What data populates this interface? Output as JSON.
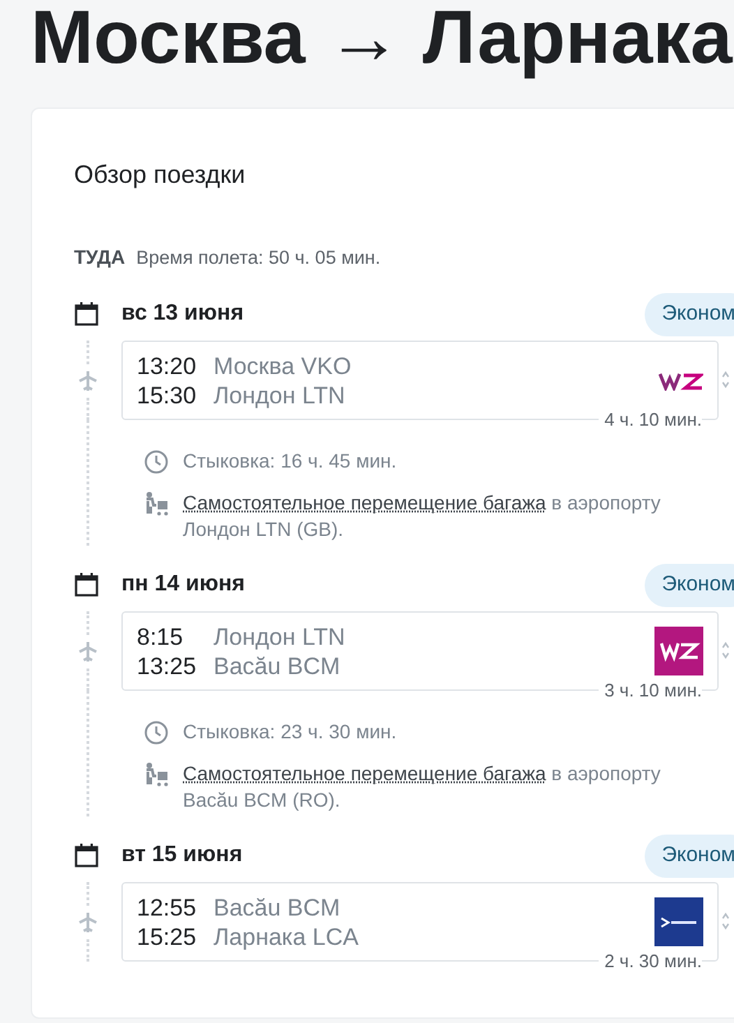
{
  "title": "Москва → Ларнака",
  "overview": {
    "heading": "Обзор поездки",
    "direction": "ТУДА",
    "flight_time": "Время полета: 50 ч. 05 мин."
  },
  "legs": [
    {
      "date": "вс 13 июня",
      "cabin": "Эконом",
      "departure": {
        "time": "13:20",
        "place": "Москва VKO"
      },
      "arrival": {
        "time": "15:30",
        "place": "Лондон LTN"
      },
      "duration": "4 ч. 10 мин.",
      "logo": {
        "kind": "wizz_plain"
      },
      "layover": {
        "connection": "Стыковка: 16 ч. 45 мин.",
        "baggage_link": "Самостоятельное перемещение багажа",
        "baggage_rest": "в аэропорту Лондон LTN (GB)."
      }
    },
    {
      "date": "пн 14 июня",
      "cabin": "Эконом",
      "departure": {
        "time": "8:15",
        "place": "Лондон LTN"
      },
      "arrival": {
        "time": "13:25",
        "place": "Bacău BCM"
      },
      "duration": "3 ч. 10 мин.",
      "logo": {
        "kind": "wizz_box"
      },
      "layover": {
        "connection": "Стыковка: 23 ч. 30 мин.",
        "baggage_link": "Самостоятельное перемещение багажа",
        "baggage_rest": "в аэропорту Bacău BCM (RO)."
      }
    },
    {
      "date": "вт 15 июня",
      "cabin": "Эконом",
      "departure": {
        "time": "12:55",
        "place": "Bacău BCM"
      },
      "arrival": {
        "time": "15:25",
        "place": "Ларнака LCA"
      },
      "duration": "2 ч. 30 мин.",
      "logo": {
        "kind": "blue_box"
      }
    }
  ]
}
